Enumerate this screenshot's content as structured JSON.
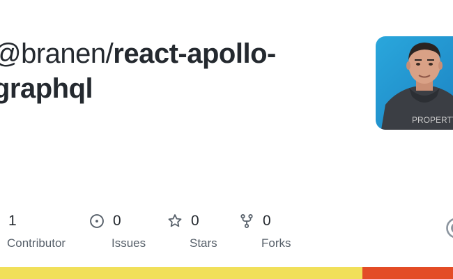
{
  "repo": {
    "owner": "@branen",
    "separator": "/",
    "name_part1": "react-apollo-",
    "name_part2": "graphql"
  },
  "avatar": {
    "alt": "owner-avatar",
    "shirt_text": "PROPERTY"
  },
  "stats": {
    "contributors": {
      "value": "1",
      "label": "Contributor",
      "icon": "people-icon"
    },
    "issues": {
      "value": "0",
      "label": "Issues",
      "icon": "issue-opened-icon"
    },
    "stars": {
      "value": "0",
      "label": "Stars",
      "icon": "star-icon"
    },
    "forks": {
      "value": "0",
      "label": "Forks",
      "icon": "repo-forked-icon"
    }
  },
  "language_bar": [
    {
      "color": "#f1e05a",
      "fraction": 0.8
    },
    {
      "color": "#e34c26",
      "fraction": 0.2
    }
  ],
  "colors": {
    "text_primary": "#24292f",
    "text_secondary": "#57606a",
    "icon": "#57606a"
  }
}
